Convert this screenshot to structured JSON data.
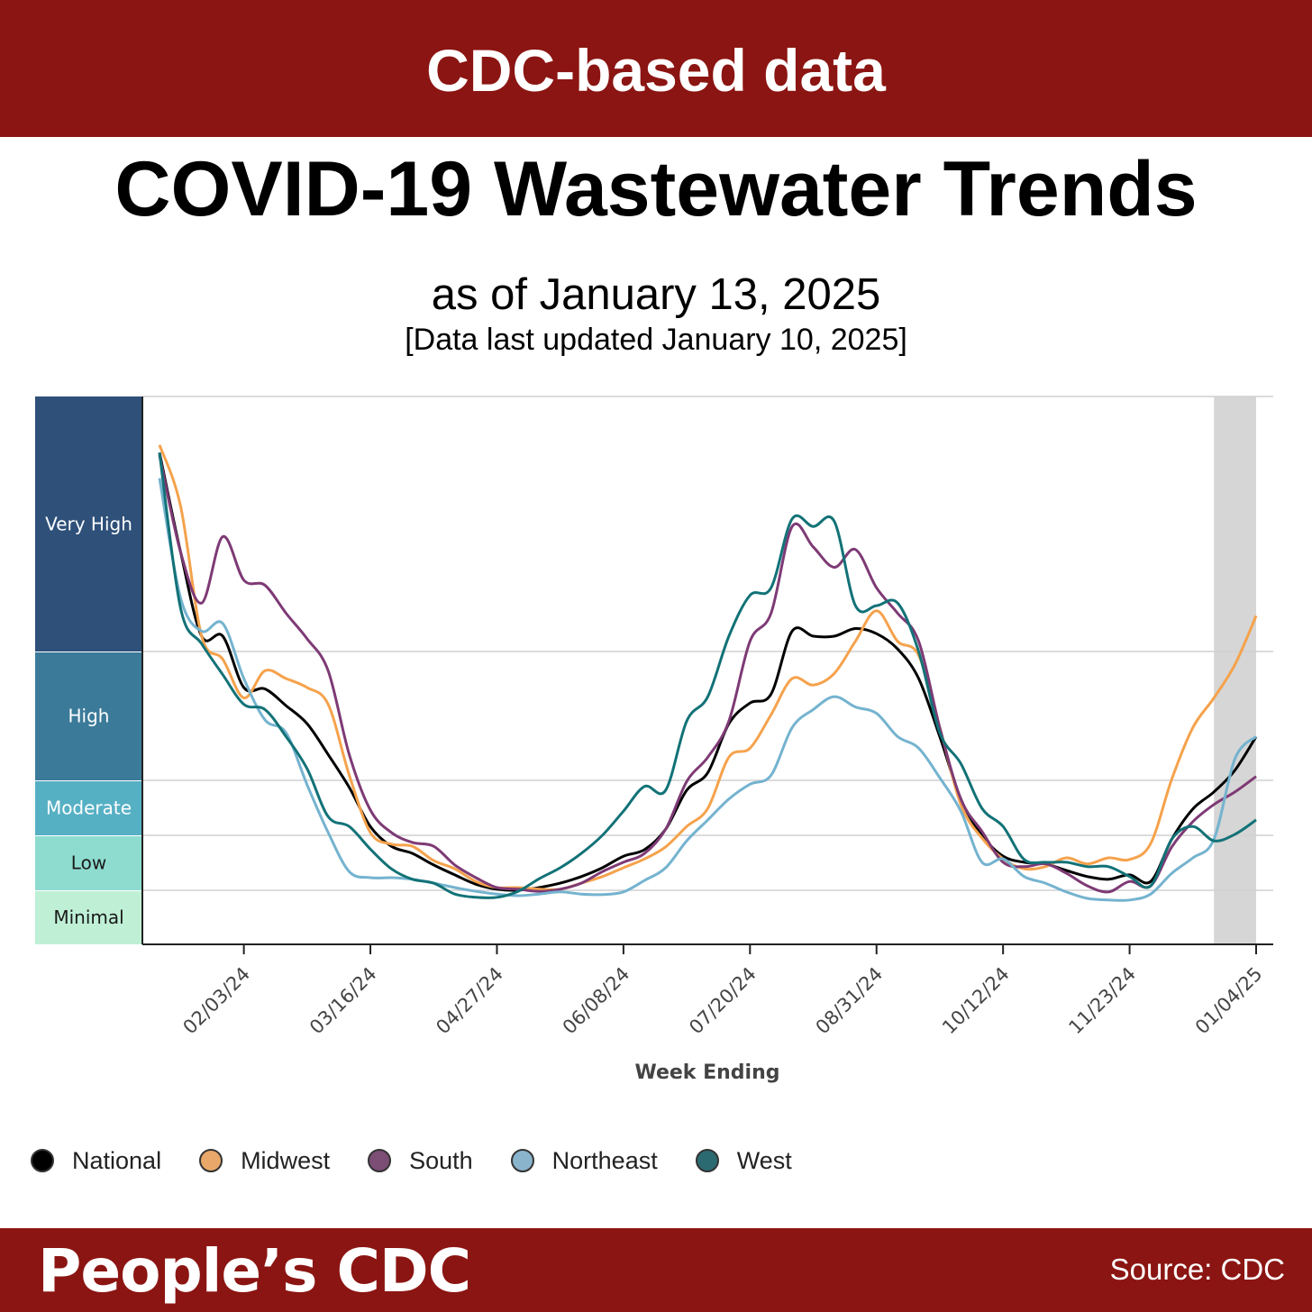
{
  "header": {
    "banner": "CDC-based data"
  },
  "title": "COVID-19 Wastewater Trends",
  "subtitle": "as of January 13, 2025",
  "updated_note": "[Data last updated January 10, 2025]",
  "footer": {
    "brand": "People’s CDC",
    "source": "Source: CDC"
  },
  "chart_data": {
    "type": "line",
    "xlabel": "Week Ending",
    "ylabel": "",
    "levels": [
      {
        "label": "Minimal",
        "color": "#bff0d6",
        "text_color": "#1a1a1a"
      },
      {
        "label": "Low",
        "color": "#8edccf",
        "text_color": "#1a1a1a"
      },
      {
        "label": "Moderate",
        "color": "#56b0c4",
        "text_color": "#ffffff"
      },
      {
        "label": "High",
        "color": "#3b7a99",
        "text_color": "#ffffff"
      },
      {
        "label": "Very High",
        "color": "#2e5079",
        "text_color": "#ffffff"
      }
    ],
    "ylim": [
      0,
      5
    ],
    "grid": true,
    "legend_position": "bottom-left",
    "xticks": [
      "02/03/24",
      "03/16/24",
      "04/27/24",
      "06/08/24",
      "07/20/24",
      "08/31/24",
      "10/12/24",
      "11/23/24",
      "01/04/25"
    ],
    "shaded_range": [
      "12/21/24",
      "01/04/25"
    ],
    "shade_color": "#d6d6d6",
    "x": [
      "01/06/24",
      "01/13/24",
      "01/20/24",
      "01/27/24",
      "02/03/24",
      "02/10/24",
      "02/17/24",
      "02/24/24",
      "03/02/24",
      "03/09/24",
      "03/16/24",
      "03/23/24",
      "03/30/24",
      "04/06/24",
      "04/13/24",
      "04/20/24",
      "04/27/24",
      "05/04/24",
      "05/11/24",
      "05/18/24",
      "05/25/24",
      "06/01/24",
      "06/08/24",
      "06/15/24",
      "06/22/24",
      "06/29/24",
      "07/06/24",
      "07/13/24",
      "07/20/24",
      "07/27/24",
      "08/03/24",
      "08/10/24",
      "08/17/24",
      "08/24/24",
      "08/31/24",
      "09/07/24",
      "09/14/24",
      "09/21/24",
      "09/28/24",
      "10/05/24",
      "10/12/24",
      "10/19/24",
      "10/26/24",
      "11/02/24",
      "11/09/24",
      "11/16/24",
      "11/23/24",
      "11/30/24",
      "12/07/24",
      "12/14/24",
      "12/21/24",
      "12/28/24",
      "01/04/25"
    ],
    "series": [
      {
        "name": "National",
        "color": "#000000",
        "legend_color": "#000000",
        "values": [
          4.78,
          4.39,
          4.06,
          4.06,
          3.72,
          3.71,
          3.58,
          3.44,
          3.2,
          2.87,
          2.16,
          1.8,
          1.67,
          1.46,
          1.28,
          1.11,
          1.02,
          1.0,
          1.05,
          1.13,
          1.25,
          1.41,
          1.62,
          1.74,
          2.11,
          2.82,
          3.06,
          3.44,
          3.6,
          3.67,
          4.08,
          4.06,
          4.06,
          4.09,
          4.07,
          4.01,
          3.79,
          3.34,
          2.66,
          2.0,
          1.62,
          1.51,
          1.48,
          1.36,
          1.25,
          1.2,
          1.28,
          1.16,
          1.93,
          2.48,
          2.79,
          3.08,
          3.34
        ]
      },
      {
        "name": "Midwest",
        "color": "#f5a24c",
        "legend_color": "#e9a86a",
        "values": [
          4.81,
          4.57,
          4.06,
          3.94,
          3.64,
          3.85,
          3.79,
          3.72,
          3.59,
          3.04,
          2.05,
          1.84,
          1.8,
          1.54,
          1.39,
          1.16,
          1.05,
          1.05,
          1.02,
          1.02,
          1.13,
          1.25,
          1.41,
          1.57,
          1.79,
          2.16,
          2.49,
          3.18,
          3.25,
          3.51,
          3.79,
          3.74,
          3.83,
          4.04,
          4.16,
          4.04,
          3.97,
          3.41,
          2.56,
          1.95,
          1.57,
          1.39,
          1.43,
          1.59,
          1.48,
          1.59,
          1.56,
          1.85,
          3.01,
          3.41,
          3.64,
          3.9,
          4.14
        ]
      },
      {
        "name": "South",
        "color": "#7e3a75",
        "legend_color": "#7c4e75",
        "values": [
          4.77,
          4.39,
          4.19,
          4.45,
          4.28,
          4.26,
          4.15,
          4.05,
          3.85,
          3.2,
          2.46,
          2.05,
          1.87,
          1.8,
          1.46,
          1.23,
          1.05,
          1.02,
          0.98,
          1.02,
          1.13,
          1.34,
          1.51,
          1.67,
          2.11,
          2.98,
          3.18,
          3.46,
          4.04,
          4.15,
          4.49,
          4.41,
          4.33,
          4.4,
          4.25,
          4.15,
          4.04,
          3.41,
          2.66,
          2.07,
          1.51,
          1.43,
          1.48,
          1.31,
          1.08,
          0.97,
          1.16,
          1.08,
          1.79,
          2.25,
          2.56,
          2.79,
          3.03
        ]
      },
      {
        "name": "Northeast",
        "color": "#74b3cf",
        "legend_color": "#8ab4cc",
        "values": [
          4.68,
          4.21,
          4.08,
          4.11,
          3.79,
          3.47,
          3.37,
          2.92,
          2.05,
          1.34,
          1.23,
          1.23,
          1.2,
          1.13,
          1.05,
          0.98,
          0.93,
          0.9,
          0.93,
          0.97,
          0.93,
          0.92,
          0.97,
          1.18,
          1.41,
          1.9,
          2.28,
          2.66,
          2.93,
          3.04,
          3.41,
          3.55,
          3.65,
          3.57,
          3.52,
          3.34,
          3.25,
          3.02,
          2.44,
          1.51,
          1.57,
          1.25,
          1.13,
          0.97,
          0.85,
          0.82,
          0.82,
          0.93,
          1.31,
          1.59,
          1.93,
          3.17,
          3.34
        ]
      },
      {
        "name": "West",
        "color": "#127277",
        "legend_color": "#2c6a72",
        "values": [
          4.78,
          4.17,
          4.03,
          3.82,
          3.59,
          3.55,
          3.34,
          3.09,
          2.34,
          2.16,
          1.75,
          1.39,
          1.2,
          1.13,
          0.93,
          0.87,
          0.87,
          0.98,
          1.21,
          1.41,
          1.67,
          2.0,
          2.44,
          2.89,
          2.82,
          3.46,
          3.65,
          4.06,
          4.22,
          4.25,
          4.52,
          4.49,
          4.51,
          4.18,
          4.18,
          4.19,
          4.0,
          3.37,
          3.13,
          2.49,
          2.16,
          1.56,
          1.51,
          1.51,
          1.43,
          1.43,
          1.25,
          1.08,
          1.93,
          2.16,
          1.9,
          2.02,
          2.28
        ]
      }
    ]
  }
}
